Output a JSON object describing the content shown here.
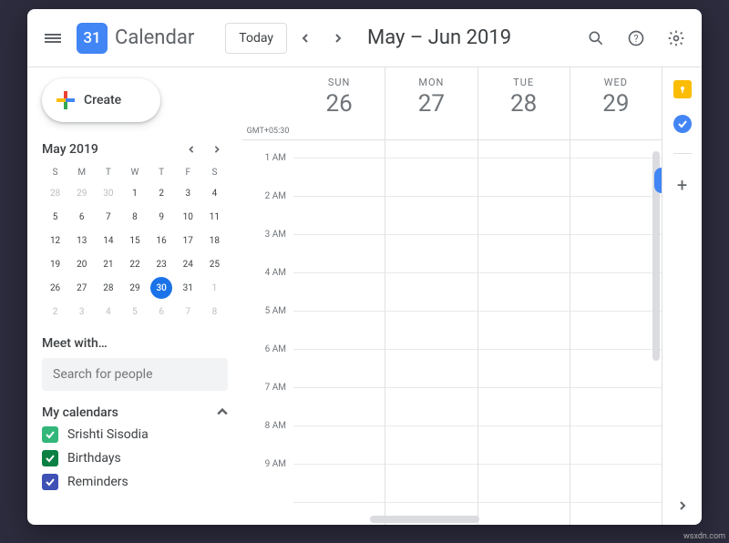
{
  "header": {
    "logo_day": "31",
    "app_title": "Calendar",
    "today_label": "Today",
    "date_range": "May – Jun 2019"
  },
  "sidebar": {
    "create_label": "Create",
    "mini_cal": {
      "title": "May 2019",
      "dow": [
        "S",
        "M",
        "T",
        "W",
        "T",
        "F",
        "S"
      ],
      "weeks": [
        [
          {
            "d": 28,
            "m": true
          },
          {
            "d": 29,
            "m": true
          },
          {
            "d": 30,
            "m": true
          },
          {
            "d": 1
          },
          {
            "d": 2
          },
          {
            "d": 3
          },
          {
            "d": 4
          }
        ],
        [
          {
            "d": 5
          },
          {
            "d": 6
          },
          {
            "d": 7
          },
          {
            "d": 8
          },
          {
            "d": 9
          },
          {
            "d": 10
          },
          {
            "d": 11
          }
        ],
        [
          {
            "d": 12
          },
          {
            "d": 13
          },
          {
            "d": 14
          },
          {
            "d": 15
          },
          {
            "d": 16
          },
          {
            "d": 17
          },
          {
            "d": 18
          }
        ],
        [
          {
            "d": 19
          },
          {
            "d": 20
          },
          {
            "d": 21
          },
          {
            "d": 22
          },
          {
            "d": 23
          },
          {
            "d": 24
          },
          {
            "d": 25
          }
        ],
        [
          {
            "d": 26
          },
          {
            "d": 27
          },
          {
            "d": 28
          },
          {
            "d": 29
          },
          {
            "d": 30,
            "today": true
          },
          {
            "d": 31
          },
          {
            "d": 1,
            "m": true
          }
        ],
        [
          {
            "d": 2,
            "m": true
          },
          {
            "d": 3,
            "m": true
          },
          {
            "d": 4,
            "m": true
          },
          {
            "d": 5,
            "m": true
          },
          {
            "d": 6,
            "m": true
          },
          {
            "d": 7,
            "m": true
          },
          {
            "d": 8,
            "m": true
          }
        ]
      ]
    },
    "meet_title": "Meet with…",
    "search_placeholder": "Search for people",
    "my_cal_title": "My calendars",
    "calendars": [
      {
        "label": "Srishti Sisodia",
        "color": "#33b679"
      },
      {
        "label": "Birthdays",
        "color": "#0b8043"
      },
      {
        "label": "Reminders",
        "color": "#3f51b5"
      }
    ]
  },
  "grid": {
    "timezone": "GMT+05:30",
    "days": [
      {
        "dow": "SUN",
        "num": "26"
      },
      {
        "dow": "MON",
        "num": "27"
      },
      {
        "dow": "TUE",
        "num": "28"
      },
      {
        "dow": "WED",
        "num": "29"
      }
    ],
    "times": [
      "1 AM",
      "2 AM",
      "3 AM",
      "4 AM",
      "5 AM",
      "6 AM",
      "7 AM",
      "8 AM",
      "9 AM"
    ]
  },
  "panel": {
    "keep_color": "#fbbc04",
    "tasks_color": "#4285f4"
  },
  "watermark": "wsxdn.com"
}
